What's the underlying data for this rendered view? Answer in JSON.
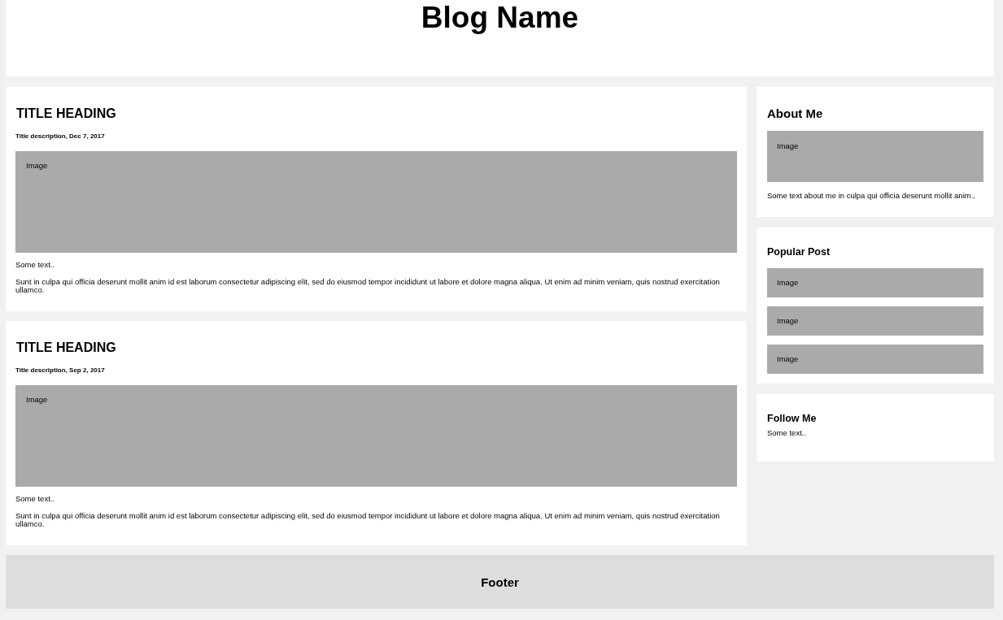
{
  "header": {
    "title": "Blog Name"
  },
  "posts": [
    {
      "title": "TITLE HEADING",
      "description": "Title description, Dec 7, 2017",
      "image_label": "Image",
      "intro": "Some text..",
      "body": "Sunt in culpa qui officia deserunt mollit anim id est laborum consectetur adipiscing elit, sed do eiusmod tempor incididunt ut labore et dolore magna aliqua. Ut enim ad minim veniam, quis nostrud exercitation ullamco."
    },
    {
      "title": "TITLE HEADING",
      "description": "Title description, Sep 2, 2017",
      "image_label": "Image",
      "intro": "Some text..",
      "body": "Sunt in culpa qui officia deserunt mollit anim id est laborum consectetur adipiscing elit, sed do eiusmod tempor incididunt ut labore et dolore magna aliqua. Ut enim ad minim veniam, quis nostrud exercitation ullamco."
    }
  ],
  "sidebar": {
    "about": {
      "title": "About Me",
      "image_label": "Image",
      "text": "Some text about me in culpa qui officia deserunt mollit anim.."
    },
    "popular": {
      "title": "Popular Post",
      "images": [
        "Image",
        "Image",
        "Image"
      ]
    },
    "follow": {
      "title": "Follow Me",
      "text": "Some text.."
    }
  },
  "footer": {
    "text": "Footer"
  }
}
